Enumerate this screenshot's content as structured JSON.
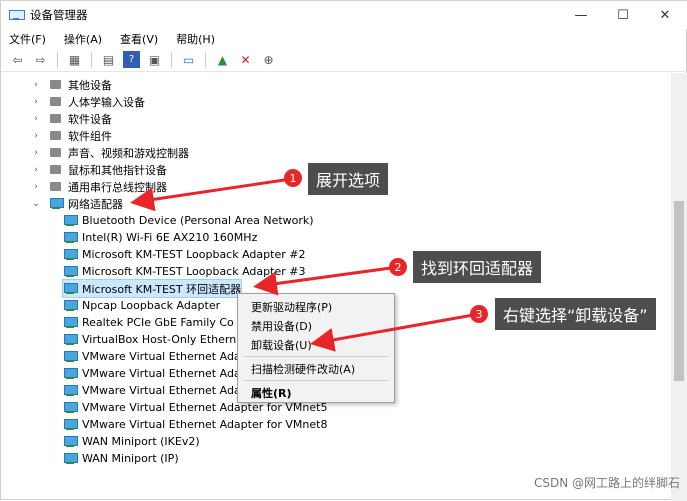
{
  "window": {
    "title": "设备管理器",
    "min": "—",
    "max": "☐",
    "close": "✕"
  },
  "menu": [
    "文件(F)",
    "操作(A)",
    "查看(V)",
    "帮助(H)"
  ],
  "categories": [
    "其他设备",
    "人体学输入设备",
    "软件设备",
    "软件组件",
    "声音、视频和游戏控制器",
    "鼠标和其他指针设备",
    "通用串行总线控制器"
  ],
  "network": {
    "label": "网络适配器",
    "devices": [
      "Bluetooth Device (Personal Area Network)",
      "Intel(R) Wi-Fi 6E AX210 160MHz",
      "Microsoft KM-TEST Loopback Adapter #2",
      "Microsoft KM-TEST Loopback Adapter #3",
      "Microsoft KM-TEST 环回适配器",
      "Npcap Loopback Adapter",
      "Realtek PCIe GbE Family Co",
      "VirtualBox Host-Only Ethern",
      "VMware Virtual Ethernet Ada",
      "VMware Virtual Ethernet Ada",
      "VMware Virtual Ethernet Ada",
      "VMware Virtual Ethernet Adapter for VMnet5",
      "VMware Virtual Ethernet Adapter for VMnet8",
      "WAN Miniport (IKEv2)",
      "WAN Miniport (IP)"
    ]
  },
  "context_menu": [
    "更新驱动程序(P)",
    "禁用设备(D)",
    "卸载设备(U)",
    "扫描检测硬件改动(A)",
    "属性(R)"
  ],
  "callouts": [
    {
      "num": "1",
      "text": "展开选项"
    },
    {
      "num": "2",
      "text": "找到环回适配器"
    },
    {
      "num": "3",
      "text": "右键选择“卸载设备”"
    }
  ],
  "watermark": "CSDN @网工路上的绊脚石",
  "colors": {
    "arrow": "#e8262a",
    "callout_bg": "#4d4d4d",
    "selection": "#cce8ff"
  }
}
